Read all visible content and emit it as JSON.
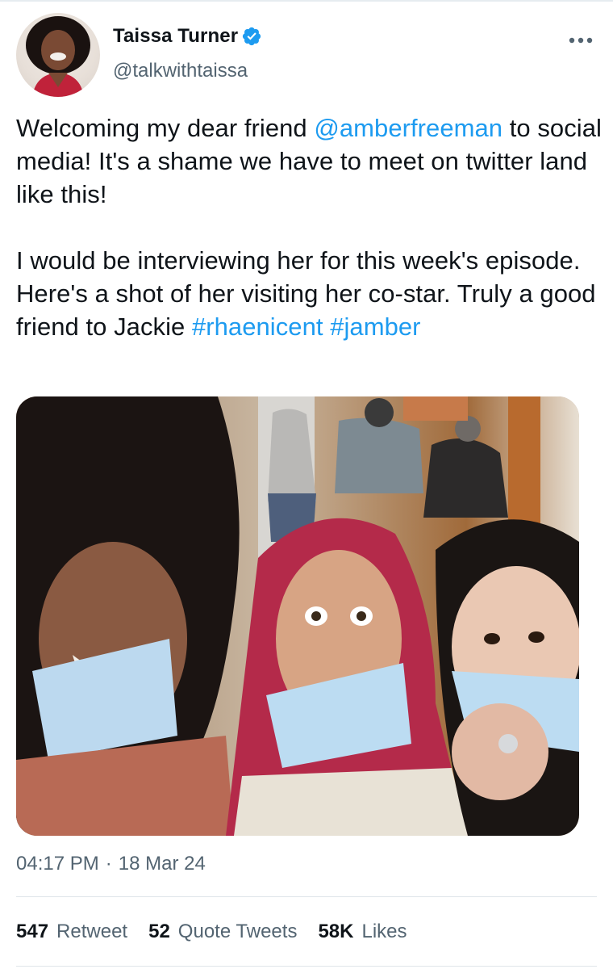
{
  "author": {
    "display_name": "Taissa Turner",
    "handle": "@talkwithtaissa",
    "verified": true,
    "avatar_icon": "profile-photo"
  },
  "tweet": {
    "p1_a": "Welcoming my dear friend ",
    "mention": "@amberfreeman",
    "p1_b": " to social media! It's a shame we have to meet on twitter land like this!",
    "p2_a": "I would be interviewing her for this week's episode. Here's a shot of her visiting her co-star. Truly a good friend to Jackie ",
    "hashtag1": "#rhaenicent",
    "hashtag2": "#jamber"
  },
  "meta": {
    "time": "04:17 PM",
    "separator": "·",
    "date": "18 Mar 24"
  },
  "stats": {
    "retweets_count": "547",
    "retweets_label": "Retweet",
    "quotes_count": "52",
    "quotes_label": "Quote Tweets",
    "likes_count": "58K",
    "likes_label": "Likes"
  },
  "colors": {
    "link": "#1d9bf0",
    "secondary_text": "#536471",
    "primary_text": "#0f1419",
    "divider": "#dfe5e9"
  },
  "icons": {
    "verified": "verified-badge-icon",
    "more": "more-options-icon"
  }
}
